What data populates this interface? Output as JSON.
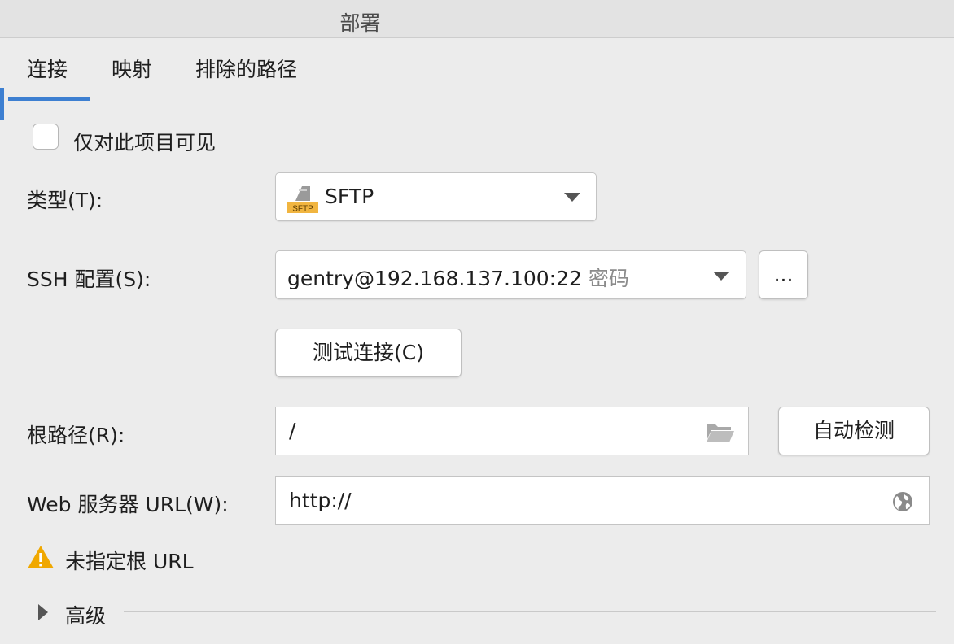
{
  "window": {
    "title": "部署"
  },
  "tabs": [
    {
      "label": "连接"
    },
    {
      "label": "映射"
    },
    {
      "label": "排除的路径"
    }
  ],
  "visible_only_project": {
    "label": "仅对此项目可见",
    "checked": false
  },
  "type": {
    "label": "类型(T):",
    "value": "SFTP",
    "icon": "sftp-icon"
  },
  "ssh": {
    "label": "SSH 配置(S):",
    "host": "gentry@192.168.137.100:22",
    "auth": "密码",
    "more_label": "..."
  },
  "test_connection": {
    "label": "测试连接(C)"
  },
  "root_path": {
    "label": "根路径(R):",
    "value": "/",
    "autodetect_label": "自动检测"
  },
  "web_url": {
    "label": "Web 服务器 URL(W):",
    "value": "http://"
  },
  "warning": {
    "text": "未指定根 URL",
    "color": "#f0a800"
  },
  "advanced": {
    "label": "高级"
  },
  "colors": {
    "accent": "#3d7fd1",
    "background": "#ececec"
  }
}
